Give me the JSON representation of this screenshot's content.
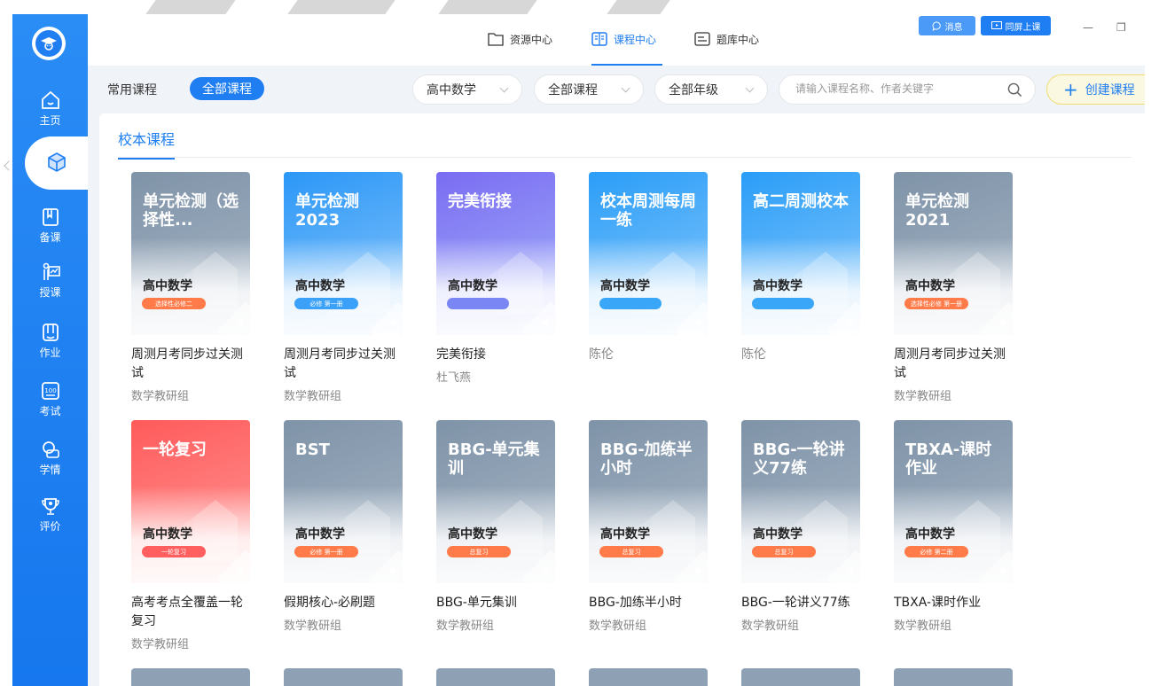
{
  "top_tabs": [
    {
      "label": "资源中心",
      "icon": "folder-icon"
    },
    {
      "label": "课程中心",
      "icon": "book-icon"
    },
    {
      "label": "题库中心",
      "icon": "list-icon"
    }
  ],
  "top_right": {
    "message_label": "消息",
    "screen_label": "同屏上课"
  },
  "sidebar": {
    "items": [
      {
        "label": "主页",
        "icon": "home-icon"
      },
      {
        "label": "资源",
        "icon": "cube-icon"
      },
      {
        "label": "备课",
        "icon": "notebook-icon"
      },
      {
        "label": "授课",
        "icon": "teach-icon"
      },
      {
        "label": "作业",
        "icon": "homework-icon"
      },
      {
        "label": "考试",
        "icon": "exam-icon"
      },
      {
        "label": "学情",
        "icon": "stats-icon"
      },
      {
        "label": "评价",
        "icon": "trophy-icon"
      }
    ]
  },
  "filters": {
    "tab_common": "常用课程",
    "tab_all": "全部课程",
    "subject": "高中数学",
    "course_type": "全部课程",
    "grade": "全部年级",
    "search_placeholder": "请输入课程名称、作者关键字",
    "create_label": "创建课程"
  },
  "section_title": "校本课程",
  "colors": {
    "accent": "#1f7ef2",
    "gray_cover": "#8ea0b3",
    "blue_cover": "#3aa6f8",
    "purple_cover": "#7b86f5",
    "red_cover": "#ff5f5f",
    "pill_orange": "#ff7b4a"
  },
  "courses": [
    {
      "cover_title": "单元检测（选择性...",
      "subject": "高中数学",
      "pill": "选择性必修二",
      "name": "周测月考同步过关测试",
      "author": "数学教研组"
    },
    {
      "cover_title": "单元检测2023",
      "subject": "高中数学",
      "pill": "必修 第一册",
      "name": "周测月考同步过关测试",
      "author": "数学教研组"
    },
    {
      "cover_title": "完美衔接",
      "subject": "高中数学",
      "pill": "",
      "name": "完美衔接",
      "author": "杜飞燕"
    },
    {
      "cover_title": "校本周测每周一练",
      "subject": "高中数学",
      "pill": "",
      "name": "陈伦",
      "author": ""
    },
    {
      "cover_title": "高二周测校本",
      "subject": "高中数学",
      "pill": "",
      "name": "陈伦",
      "author": ""
    },
    {
      "cover_title": "单元检测2021",
      "subject": "高中数学",
      "pill": "选择性必修 第一册",
      "name": "周测月考同步过关测试",
      "author": "数学教研组"
    },
    {
      "cover_title": "一轮复习",
      "subject": "高中数学",
      "pill": "一轮复习",
      "name": "高考考点全覆盖一轮复习",
      "author": "数学教研组"
    },
    {
      "cover_title": "BST",
      "subject": "高中数学",
      "pill": "必修 第一册",
      "name": "假期核心-必刷题",
      "author": "数学教研组"
    },
    {
      "cover_title": "BBG-单元集训",
      "subject": "高中数学",
      "pill": "总复习",
      "name": "BBG-单元集训",
      "author": "数学教研组"
    },
    {
      "cover_title": "BBG-加练半小时",
      "subject": "高中数学",
      "pill": "总复习",
      "name": "BBG-加练半小时",
      "author": "数学教研组"
    },
    {
      "cover_title": "BBG-一轮讲义77练",
      "subject": "高中数学",
      "pill": "总复习",
      "name": "BBG-一轮讲义77练",
      "author": "数学教研组"
    },
    {
      "cover_title": "TBXA-课时作业",
      "subject": "高中数学",
      "pill": "必修 第二册",
      "name": "TBXA-课时作业",
      "author": "数学教研组"
    }
  ]
}
